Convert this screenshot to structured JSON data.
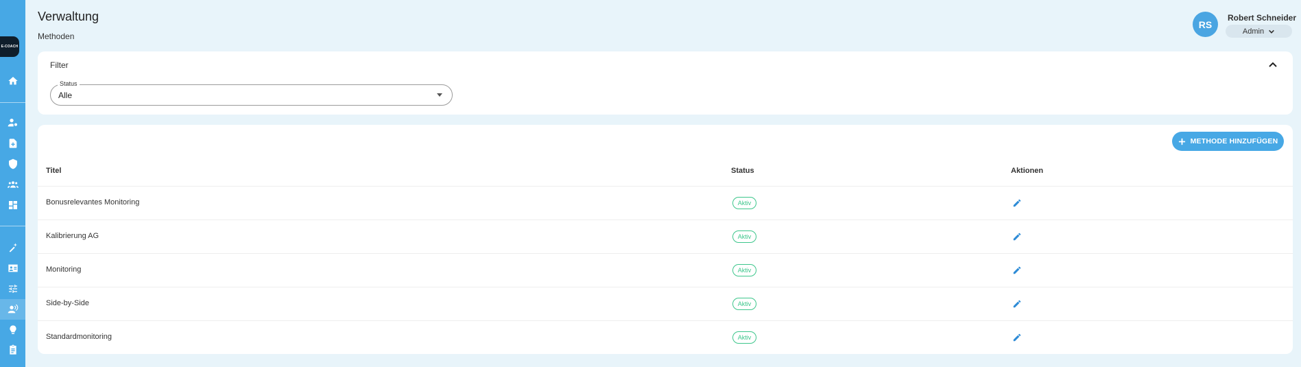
{
  "sidebar": {
    "logo_text": "E-COACH",
    "icons": [
      "home-icon",
      "user-settings-icon",
      "add-document-icon",
      "shield-add-icon",
      "group-icon",
      "dashboard-icon",
      "sparkle-wand-icon",
      "contact-card-icon",
      "tune-icon",
      "user-voice-icon",
      "lightbulb-icon",
      "clipboard-icon"
    ],
    "active": "user-voice-icon"
  },
  "header": {
    "title": "Verwaltung",
    "subtitle": "Methoden"
  },
  "user": {
    "initials": "RS",
    "name": "Robert Schneider",
    "role": "Admin"
  },
  "filter": {
    "title": "Filter",
    "status_label": "Status",
    "status_value": "Alle"
  },
  "table": {
    "add_button_label": "METHODE HINZUFÜGEN",
    "columns": {
      "title": "Titel",
      "status": "Status",
      "actions": "Aktionen"
    },
    "rows": [
      {
        "title": "Bonusrelevantes Monitoring",
        "status": "Aktiv"
      },
      {
        "title": "Kalibrierung AG",
        "status": "Aktiv"
      },
      {
        "title": "Monitoring",
        "status": "Aktiv"
      },
      {
        "title": "Side-by-Side",
        "status": "Aktiv"
      },
      {
        "title": "Standardmonitoring",
        "status": "Aktiv"
      }
    ]
  },
  "colors": {
    "sidebar": "#47a8e5",
    "accent": "#47a8e5",
    "status_active": "#3cc68b",
    "background": "#e8f4fa"
  }
}
